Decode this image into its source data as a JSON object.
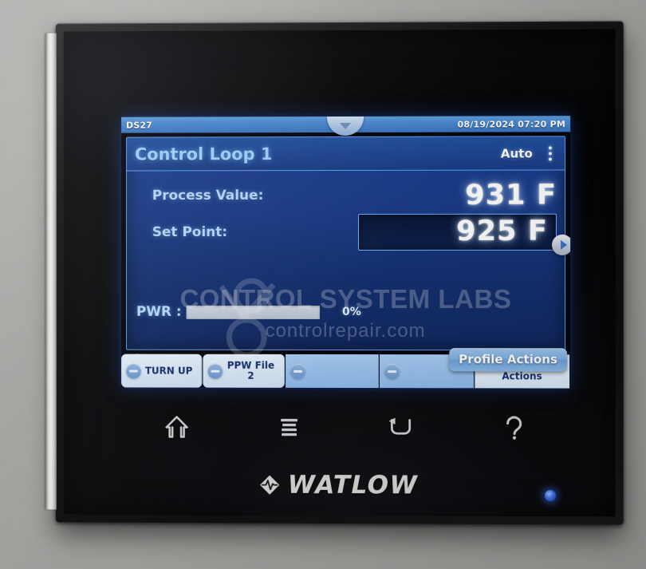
{
  "device": {
    "brand": "WATLOW",
    "brand_mark_icon": "watlow-diamond-icon"
  },
  "screen": {
    "status_bar": {
      "device_id": "DS27",
      "datetime": "08/19/2024 07:20 PM",
      "handle_icon": "pull-down-handle-icon"
    },
    "loop_panel": {
      "title": "Control Loop 1",
      "mode": "Auto",
      "menu_icon": "kebab-menu-icon",
      "rows": [
        {
          "label": "Process Value:",
          "value": "931 F",
          "editable": false
        },
        {
          "label": "Set Point:",
          "value": "925 F",
          "editable": true
        }
      ],
      "power": {
        "label": "PWR :",
        "percent_text": "0%",
        "percent_value": 0
      },
      "next_page_icon": "chevron-right-icon"
    },
    "status_line": {
      "icon": "profile-running-check-icon",
      "text": "TURN UP"
    },
    "profile_actions_button": {
      "label": "Profile Actions"
    },
    "function_buttons": [
      {
        "label": "TURN UP",
        "icon": "minus-circle-icon",
        "style": "raised"
      },
      {
        "label": "PPW File\n2",
        "icon": "minus-circle-icon",
        "style": "raised"
      },
      {
        "label": "",
        "icon": "minus-circle-icon",
        "style": "flat"
      },
      {
        "label": "",
        "icon": "minus-circle-icon",
        "style": "flat"
      },
      {
        "label": "Output\nActions",
        "icon": null,
        "style": "light"
      }
    ],
    "watermark": {
      "primary": "CONTROL SYSTEM LABS",
      "secondary": "controlrepair.com"
    }
  },
  "nav_buttons": [
    {
      "name": "home",
      "icon": "home-icon"
    },
    {
      "name": "menu",
      "icon": "menu-lines-icon"
    },
    {
      "name": "back",
      "icon": "back-arrow-icon"
    },
    {
      "name": "help",
      "icon": "question-mark-icon"
    }
  ],
  "colors": {
    "panel_blue": "#1b3f8f",
    "accent_cyan": "#9fd0ff",
    "status_bar_blue": "#4a88cf",
    "button_face": "#dbe9f8",
    "led_blue": "#3f6fe8"
  }
}
